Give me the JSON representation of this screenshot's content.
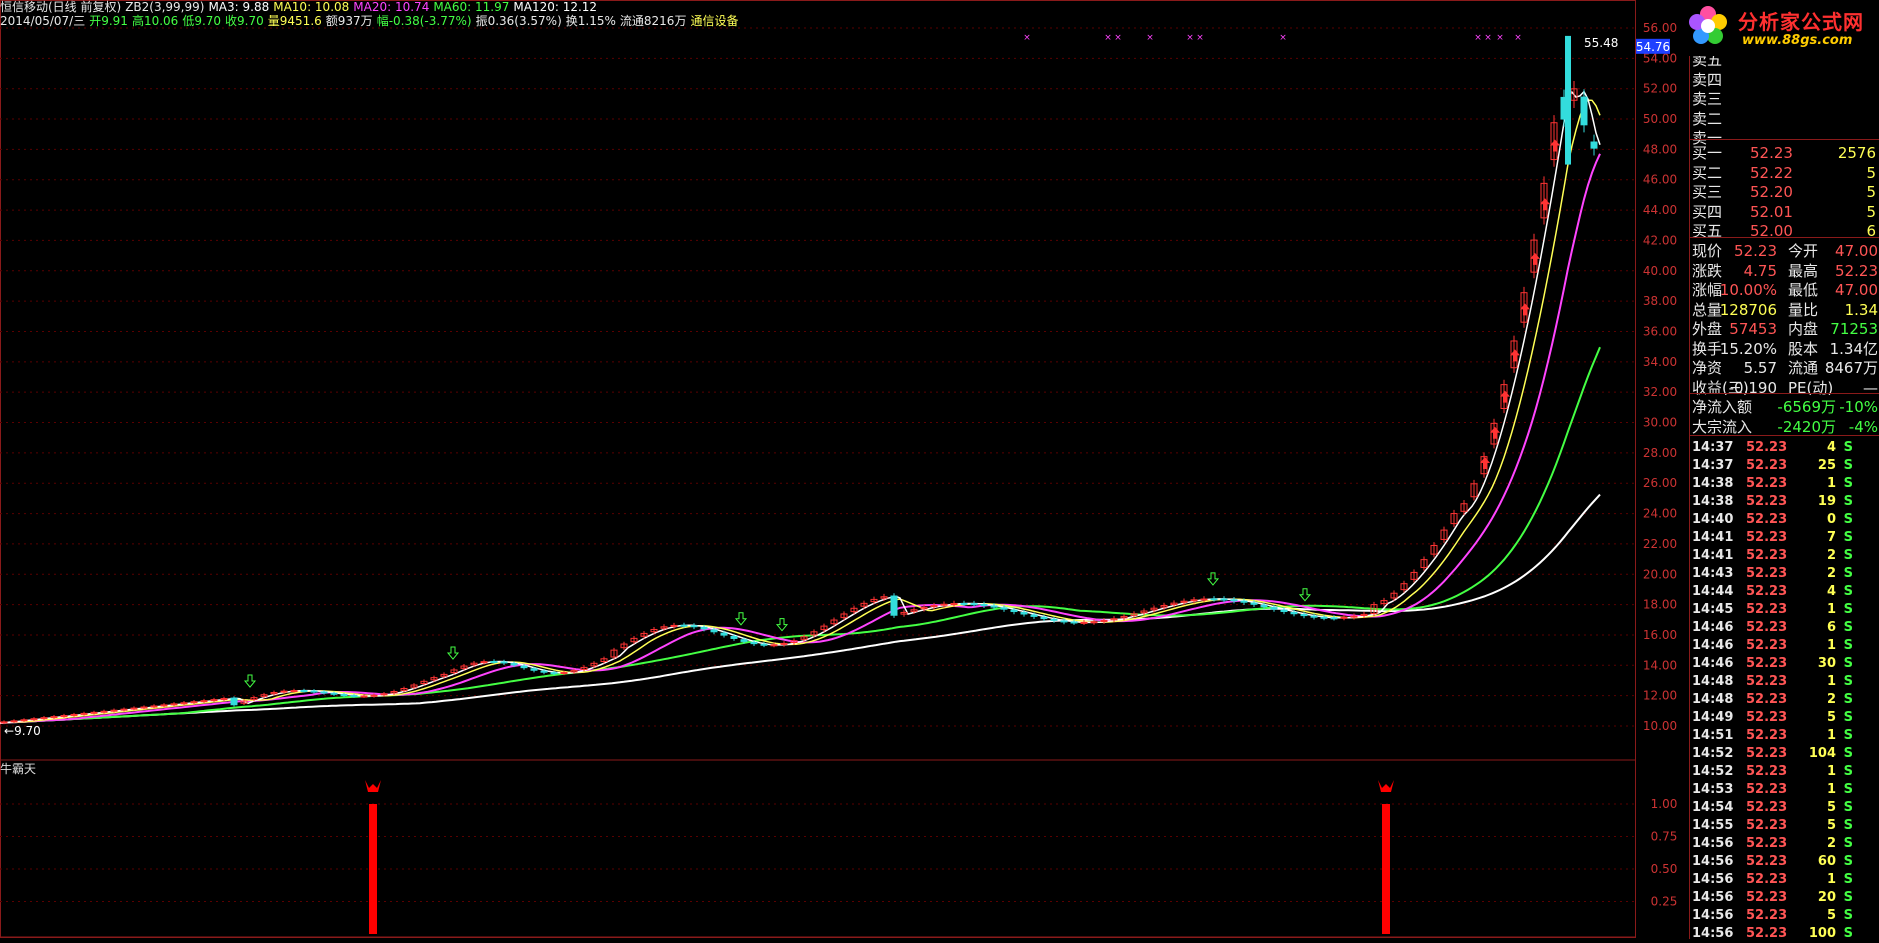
{
  "header": {
    "line1": [
      {
        "text": "恒信移动(日线 前复权)",
        "color": "#e8e8e8"
      },
      {
        "text": "ZB2(3,99,99)",
        "color": "#e8e8e8"
      },
      {
        "text": "MA3: 9.88",
        "color": "#ffffff"
      },
      {
        "text": "MA10: 10.08",
        "color": "#ffff55"
      },
      {
        "text": "MA20: 10.74",
        "color": "#ff44ff"
      },
      {
        "text": "MA60: 11.97",
        "color": "#44ff44"
      },
      {
        "text": "MA120: 12.12",
        "color": "#ffffff"
      }
    ],
    "line2": [
      {
        "text": "2014/05/07/三",
        "color": "#e8e8e8"
      },
      {
        "text": "开9.91",
        "color": "#44ff44"
      },
      {
        "text": "高10.06",
        "color": "#44ff44"
      },
      {
        "text": "低9.70",
        "color": "#44ff44"
      },
      {
        "text": "收9.70",
        "color": "#44ff44"
      },
      {
        "text": "量9451.6",
        "color": "#ffff55"
      },
      {
        "text": "额937万",
        "color": "#e8e8e8"
      },
      {
        "text": "幅-0.38(-3.77%)",
        "color": "#44ff44"
      },
      {
        "text": "振0.36(3.57%)",
        "color": "#e8e8e8"
      },
      {
        "text": "换1.15%",
        "color": "#e8e8e8"
      },
      {
        "text": "流通8216万",
        "color": "#e8e8e8"
      },
      {
        "text": "通信设备",
        "color": "#ffff55"
      }
    ]
  },
  "price_axis": {
    "ticks": [
      "56.00",
      "54.00",
      "52.00",
      "50.00",
      "48.00",
      "46.00",
      "44.00",
      "42.00",
      "40.00",
      "38.00",
      "36.00",
      "34.00",
      "32.00",
      "30.00",
      "28.00",
      "26.00",
      "24.00",
      "22.00",
      "20.00",
      "18.00",
      "16.00",
      "14.00",
      "12.00",
      "10.00"
    ],
    "current_price_tag": "54.76",
    "max_label": "55.48",
    "min_label": "9.70"
  },
  "indicator": {
    "name": "牛霸天",
    "ticks": [
      "1.00",
      "0.75",
      "0.50",
      "0.25"
    ]
  },
  "logo": {
    "text": "分析家公式网",
    "url_text": "www.88gs.com"
  },
  "order_book": {
    "sell": [
      {
        "label": "卖五"
      },
      {
        "label": "卖四"
      },
      {
        "label": "卖三"
      },
      {
        "label": "卖二"
      },
      {
        "label": "卖一"
      }
    ],
    "buy": [
      {
        "label": "买一",
        "price": "52.23",
        "vol": "2576"
      },
      {
        "label": "买二",
        "price": "52.22",
        "vol": "5"
      },
      {
        "label": "买三",
        "price": "52.20",
        "vol": "5"
      },
      {
        "label": "买四",
        "price": "52.01",
        "vol": "5"
      },
      {
        "label": "买五",
        "price": "52.00",
        "vol": "6"
      }
    ]
  },
  "quote": [
    {
      "l1": "现价",
      "v1": "52.23",
      "c1": "#ff5555",
      "l2": "今开",
      "v2": "47.00",
      "c2": "#ff5555"
    },
    {
      "l1": "涨跌",
      "v1": "4.75",
      "c1": "#ff5555",
      "l2": "最高",
      "v2": "52.23",
      "c2": "#ff5555"
    },
    {
      "l1": "涨幅",
      "v1": "10.00%",
      "c1": "#ff5555",
      "l2": "最低",
      "v2": "47.00",
      "c2": "#ff5555"
    },
    {
      "l1": "总量",
      "v1": "128706",
      "c1": "#ffff55",
      "l2": "量比",
      "v2": "1.34",
      "c2": "#ffff55"
    },
    {
      "l1": "外盘",
      "v1": "57453",
      "c1": "#ff5555",
      "l2": "内盘",
      "v2": "71253",
      "c2": "#44ff44"
    },
    {
      "l1": "换手",
      "v1": "15.20%",
      "c1": "#e8e8e8",
      "l2": "股本",
      "v2": "1.34亿",
      "c2": "#e8e8e8"
    },
    {
      "l1": "净资",
      "v1": "5.57",
      "c1": "#e8e8e8",
      "l2": "流通",
      "v2": "8467万",
      "c2": "#e8e8e8"
    },
    {
      "l1": "收益(三)",
      "v1": "-0.190",
      "c1": "#e8e8e8",
      "l2": "PE(动)",
      "v2": "—",
      "c2": "#e8e8e8"
    }
  ],
  "flow": [
    {
      "label": "净流入额",
      "v1": "-6569万",
      "v2": "-10%"
    },
    {
      "label": "大宗流入",
      "v1": "-2420万",
      "v2": "-4%"
    }
  ],
  "ticks": [
    {
      "t": "14:37",
      "p": "52.23",
      "v": "4",
      "s": "S"
    },
    {
      "t": "14:37",
      "p": "52.23",
      "v": "25",
      "s": "S"
    },
    {
      "t": "14:38",
      "p": "52.23",
      "v": "1",
      "s": "S"
    },
    {
      "t": "14:38",
      "p": "52.23",
      "v": "19",
      "s": "S"
    },
    {
      "t": "14:40",
      "p": "52.23",
      "v": "0",
      "s": "S"
    },
    {
      "t": "14:41",
      "p": "52.23",
      "v": "7",
      "s": "S"
    },
    {
      "t": "14:41",
      "p": "52.23",
      "v": "2",
      "s": "S"
    },
    {
      "t": "14:43",
      "p": "52.23",
      "v": "2",
      "s": "S"
    },
    {
      "t": "14:44",
      "p": "52.23",
      "v": "4",
      "s": "S"
    },
    {
      "t": "14:45",
      "p": "52.23",
      "v": "1",
      "s": "S"
    },
    {
      "t": "14:46",
      "p": "52.23",
      "v": "6",
      "s": "S"
    },
    {
      "t": "14:46",
      "p": "52.23",
      "v": "1",
      "s": "S"
    },
    {
      "t": "14:46",
      "p": "52.23",
      "v": "30",
      "s": "S"
    },
    {
      "t": "14:48",
      "p": "52.23",
      "v": "1",
      "s": "S"
    },
    {
      "t": "14:48",
      "p": "52.23",
      "v": "2",
      "s": "S"
    },
    {
      "t": "14:49",
      "p": "52.23",
      "v": "5",
      "s": "S"
    },
    {
      "t": "14:51",
      "p": "52.23",
      "v": "1",
      "s": "S"
    },
    {
      "t": "14:52",
      "p": "52.23",
      "v": "104",
      "s": "S"
    },
    {
      "t": "14:52",
      "p": "52.23",
      "v": "1",
      "s": "S"
    },
    {
      "t": "14:53",
      "p": "52.23",
      "v": "1",
      "s": "S"
    },
    {
      "t": "14:54",
      "p": "52.23",
      "v": "5",
      "s": "S"
    },
    {
      "t": "14:55",
      "p": "52.23",
      "v": "5",
      "s": "S"
    },
    {
      "t": "14:56",
      "p": "52.23",
      "v": "2",
      "s": "S"
    },
    {
      "t": "14:56",
      "p": "52.23",
      "v": "60",
      "s": "S"
    },
    {
      "t": "14:56",
      "p": "52.23",
      "v": "1",
      "s": "S"
    },
    {
      "t": "14:56",
      "p": "52.23",
      "v": "20",
      "s": "S"
    },
    {
      "t": "14:56",
      "p": "52.23",
      "v": "5",
      "s": "S"
    },
    {
      "t": "14:56",
      "p": "52.23",
      "v": "100",
      "s": "S"
    }
  ],
  "colors": {
    "up": "#ff3333",
    "down": "#33dddd",
    "ma3": "#ffffff",
    "ma10": "#ffff55",
    "ma20": "#ff44ff",
    "ma60": "#44ff44",
    "ma120": "#ffffff",
    "grid": "#5a0000",
    "signal": "#ff0000"
  }
}
